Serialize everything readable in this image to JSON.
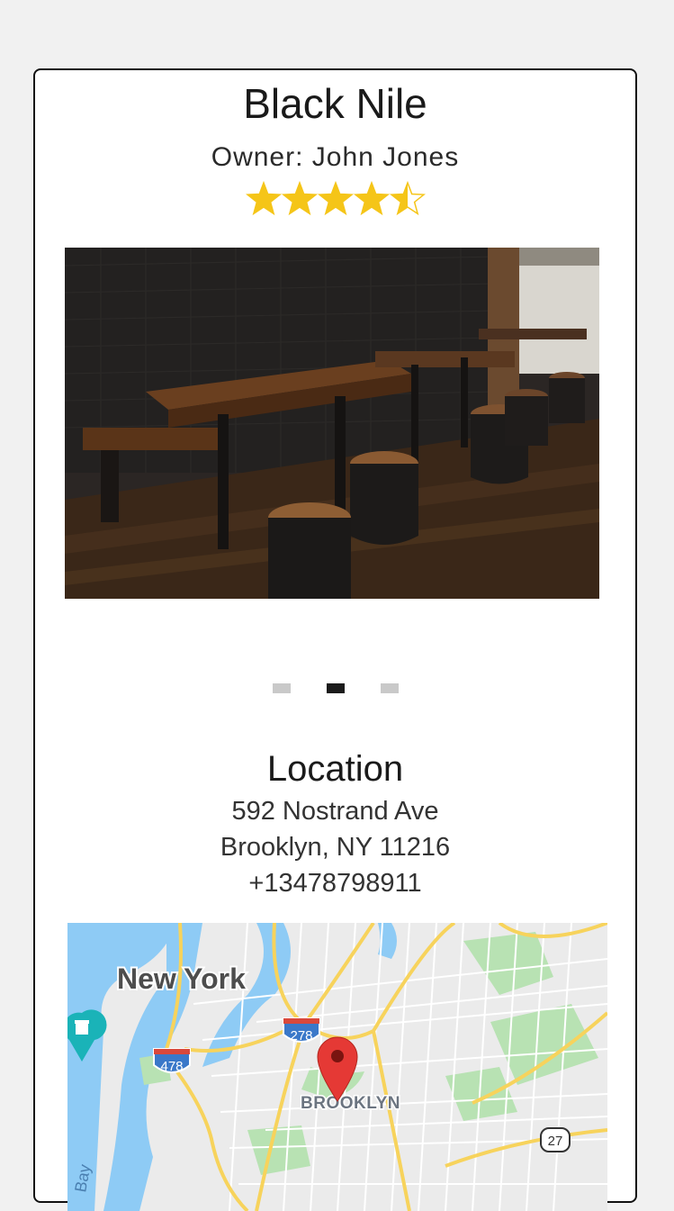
{
  "business": {
    "name": "Black Nile",
    "owner": "Owner: John Jones",
    "rating": 4.5,
    "rating_max": 5
  },
  "carousel": {
    "slide_count": 3,
    "active_index": 1
  },
  "location": {
    "heading": "Location",
    "street": "592 Nostrand Ave",
    "city_line": "Brooklyn, NY 11216",
    "phone": "+13478798911"
  },
  "map": {
    "city_label": "New York",
    "borough_label": "BROOKLYN",
    "shield_278": "278",
    "shield_478": "478",
    "route_27": "27",
    "water_label": "Bay"
  },
  "colors": {
    "star": "#f5c518",
    "pin": "#e53935",
    "water": "#8ecbf5",
    "park": "#b8e2b3",
    "highway": "#f7d35c",
    "interstate": "#3a78c9"
  }
}
